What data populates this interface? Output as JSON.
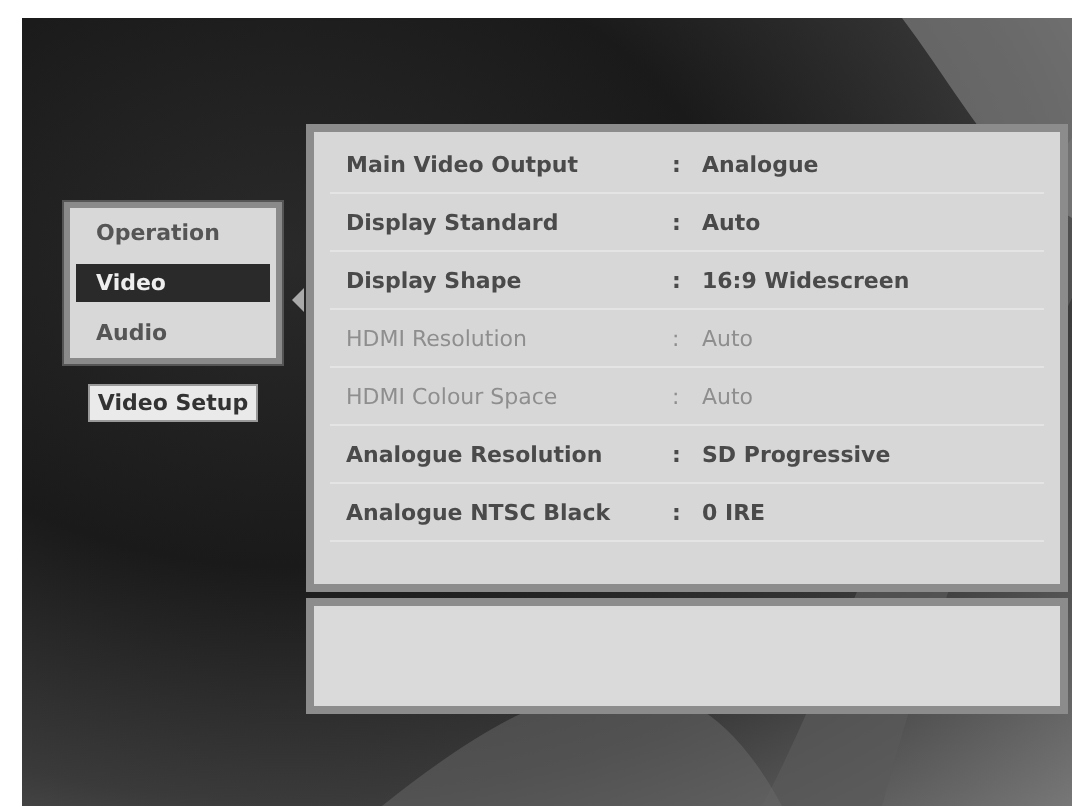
{
  "category_menu": {
    "items": [
      {
        "label": "Operation",
        "selected": false
      },
      {
        "label": "Video",
        "selected": true
      },
      {
        "label": "Audio",
        "selected": false
      }
    ]
  },
  "section_label": "Video Setup",
  "settings": [
    {
      "label": "Main Video Output",
      "separator": ":",
      "value": "Analogue",
      "disabled": false
    },
    {
      "label": "Display Standard",
      "separator": ":",
      "value": "Auto",
      "disabled": false
    },
    {
      "label": "Display Shape",
      "separator": ":",
      "value": "16:9 Widescreen",
      "disabled": false
    },
    {
      "label": "HDMI Resolution",
      "separator": ":",
      "value": "Auto",
      "disabled": true
    },
    {
      "label": "HDMI Colour Space",
      "separator": ":",
      "value": "Auto",
      "disabled": true
    },
    {
      "label": "Analogue Resolution",
      "separator": ":",
      "value": "SD Progressive",
      "disabled": false
    },
    {
      "label": "Analogue NTSC Black",
      "separator": ":",
      "value": "0 IRE",
      "disabled": false
    }
  ]
}
